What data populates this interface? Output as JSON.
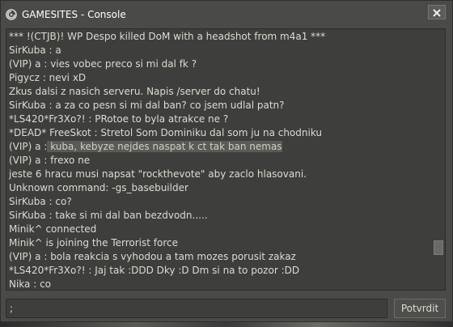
{
  "window": {
    "title": "GAMESITES - Console",
    "logo_icon": "gamesites-logo-icon",
    "close_icon": "close-x-icon"
  },
  "log": {
    "lines": [
      {
        "text": "*** !(CTJB)! WP Despo killed DoM with a headshot from m4a1 ***"
      },
      {
        "text": "SirKuba : a"
      },
      {
        "text": "(VIP) a : vies vobec preco si mi dal fk ?"
      },
      {
        "text": "Pigycz : nevi xD"
      },
      {
        "text": "Zkus dalsi z nasich serveru. Napis /server do chatu!"
      },
      {
        "text": "SirKuba : a za co pesn si mi dal ban? co jsem udlal patn?"
      },
      {
        "text": "*LS420*Fr3Xo?! : PRotoe to byla atrakce ne ?"
      },
      {
        "text": "*DEAD* FreeSkot : Stretol Som Dominiku dal som ju na chodniku"
      },
      {
        "prefix": "(VIP) a :",
        "selected": " kuba, kebyze nejdes naspat k ct tak ban nemas"
      },
      {
        "text": "(VIP) a : frexo ne"
      },
      {
        "text": "jeste 6 hracu musi napsat \"rockthevote\" aby zaclo hlasovani."
      },
      {
        "text": "Unknown command: -gs_basebuilder"
      },
      {
        "text": "SirKuba : co?"
      },
      {
        "text": "SirKuba : take si mi dal ban bezdvodn....."
      },
      {
        "text": "Minik^ connected"
      },
      {
        "text": "Minik^ is joining the Terrorist force"
      },
      {
        "text": "(VIP) a : bola reakcia s vyhodou a tam mozes porusit zakaz"
      },
      {
        "text": "*LS420*Fr3Xo?! : Jaj tak :DDD Dky :D Dm si na to pozor :DD"
      },
      {
        "text": "Nika : co"
      }
    ]
  },
  "command": {
    "value": ";"
  },
  "submit": {
    "label": "Potvrdit"
  }
}
